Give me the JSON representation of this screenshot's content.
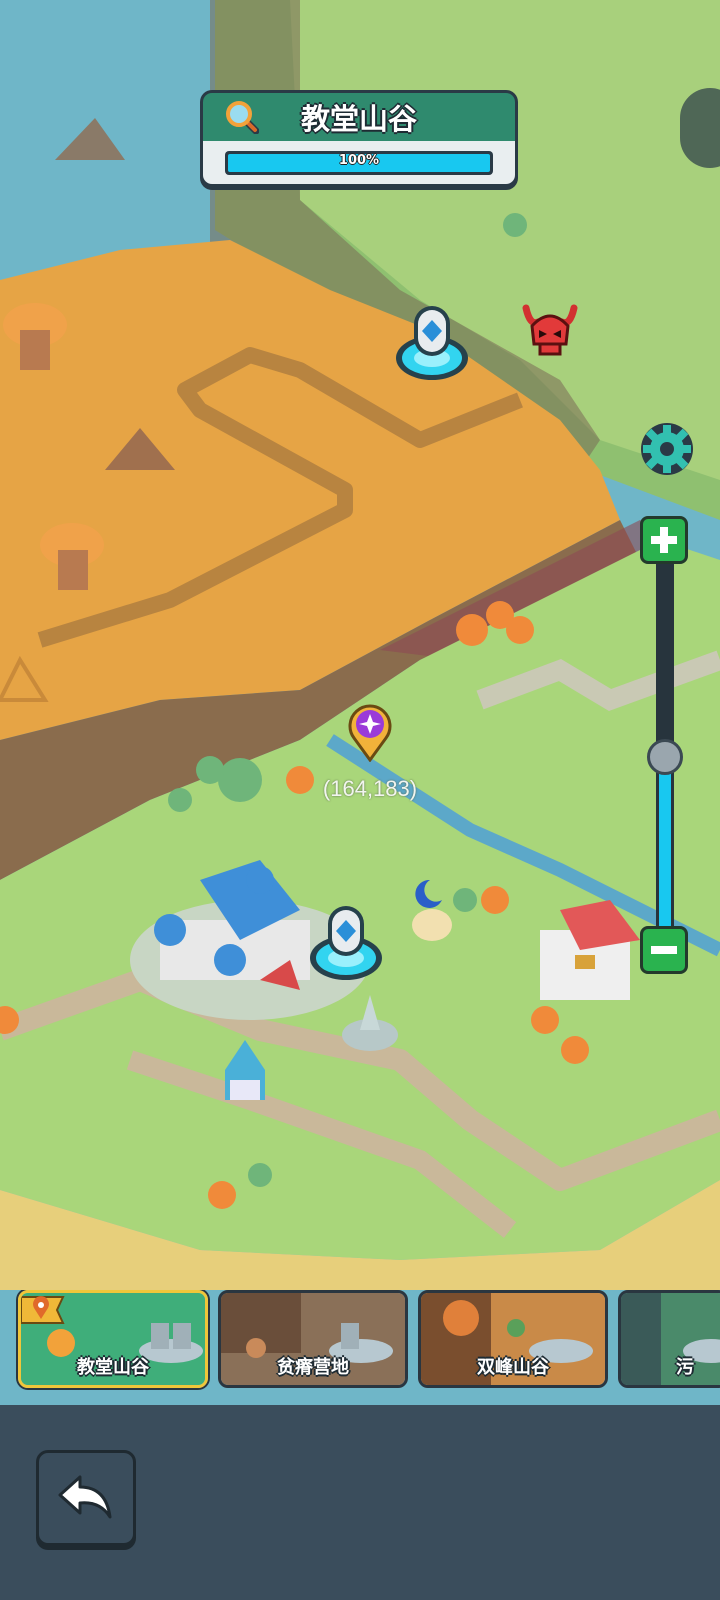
{
  "location": {
    "title": "教堂山谷",
    "progress_text": "100%",
    "progress": 1.0
  },
  "map": {
    "coordinates": "(164,183)"
  },
  "zoom": {
    "level": 0.47
  },
  "regions": [
    {
      "name": "教堂山谷",
      "selected": true,
      "color": "#3fae7a"
    },
    {
      "name": "贫瘠营地",
      "selected": false,
      "color": "#8a7058"
    },
    {
      "name": "双峰山谷",
      "selected": false,
      "color": "#9a6a3e"
    },
    {
      "name": "污",
      "selected": false,
      "color": "#4a8a6a"
    }
  ],
  "colors": {
    "sea": "#6fb6c8",
    "sand": "#e9a94a",
    "grass": "#a9d67a",
    "accent": "#18c8f0",
    "zoom_button": "#2ab34f"
  },
  "icons": {
    "search": "magnifier-icon",
    "settings": "gear-icon",
    "enemy": "demon-skull-icon",
    "waypoint": "purple-star-marker-icon",
    "portal": "teleport-portal-icon",
    "back": "back-arrow-icon"
  }
}
